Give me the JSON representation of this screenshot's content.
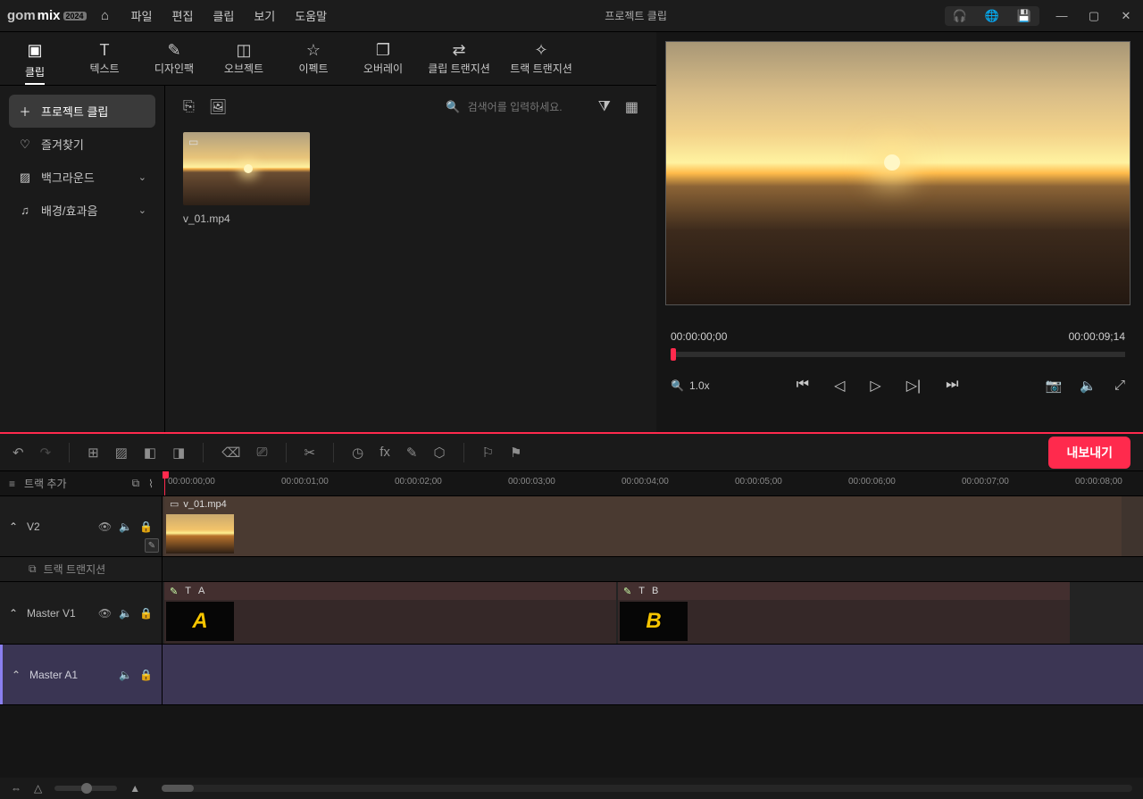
{
  "app": {
    "brand_gom": "gom",
    "brand_mix": "mix",
    "brand_badge": "2024",
    "project_title": "프로젝트 클립"
  },
  "menu": {
    "file": "파일",
    "edit": "편집",
    "clip": "클립",
    "view": "보기",
    "help": "도움말"
  },
  "tabs": {
    "clip": "클립",
    "text": "텍스트",
    "designpack": "디자인팩",
    "object": "오브젝트",
    "effect": "이펙트",
    "overlay": "오버레이",
    "clip_transition": "클립 트랜지션",
    "track_transition": "트랙 트랜지션"
  },
  "sidebar": {
    "project_clip": "프로젝트 클립",
    "favorites": "즐겨찾기",
    "background": "백그라운드",
    "bgm_sfx": "배경/효과음"
  },
  "browser": {
    "search_placeholder": "검색어를 입력하세요.",
    "clip_name": "v_01.mp4"
  },
  "preview": {
    "time_current": "00:00:00;00",
    "time_total": "00:00:09;14",
    "zoom": "1.0x"
  },
  "timeline": {
    "add_track": "트랙 추가",
    "ticks": [
      "00:00:00;00",
      "00:00:01;00",
      "00:00:02;00",
      "00:00:03;00",
      "00:00:04;00",
      "00:00:05;00",
      "00:00:06;00",
      "00:00:07;00",
      "00:00:08;00"
    ],
    "export": "내보내기",
    "tracks": {
      "v2": "V2",
      "v2_clip": "v_01.mp4",
      "transition": "트랙 트랜지션",
      "mv1": "Master V1",
      "clipA": "A",
      "clipA_glyph": "A",
      "clipB": "B",
      "clipB_glyph": "B",
      "ma1": "Master A1"
    }
  }
}
